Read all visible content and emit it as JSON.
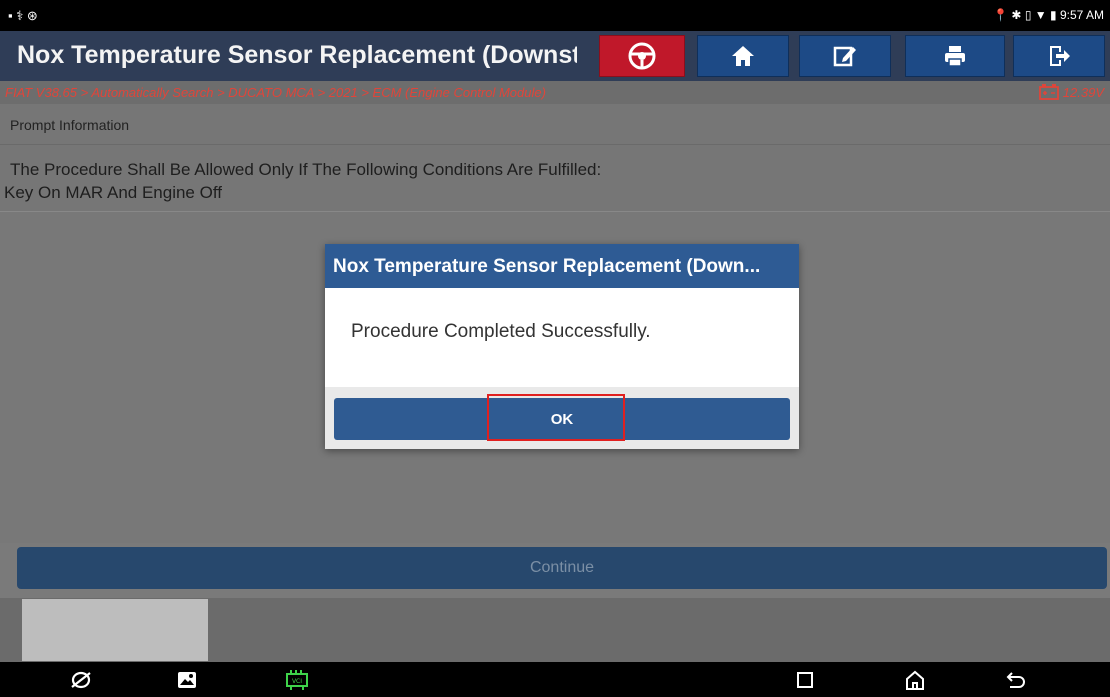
{
  "status_bar": {
    "left_icons": "▪ ⚕ ⊛",
    "time": "9:57 AM",
    "icons": [
      "location-icon",
      "bluetooth-icon",
      "vibrate-icon",
      "wifi-icon",
      "battery-icon"
    ]
  },
  "header": {
    "title": "Nox Temperature Sensor Replacement (Downst",
    "buttons": [
      "steering-wheel-icon",
      "home-icon",
      "edit-icon",
      "print-icon",
      "exit-icon"
    ],
    "colors": {
      "active": "#c0182a",
      "normal": "#1d4a86",
      "bar": "#2f3d57"
    }
  },
  "breadcrumb": {
    "path": "FIAT V38.65 > Automatically Search > DUCATO MCA > 2021 > ECM (Engine Control Module)",
    "voltage": "12.39V",
    "color": "#e0453a"
  },
  "prompt": {
    "heading": "Prompt Information",
    "line1": "The Procedure Shall Be Allowed Only If The Following Conditions Are Fulfilled:",
    "line2": "Key On MAR And Engine Off"
  },
  "dialog": {
    "title": "Nox Temperature Sensor Replacement (Down...",
    "message": "Procedure Completed Successfully.",
    "ok_label": "OK"
  },
  "footer": {
    "continue_label": "Continue"
  },
  "nav_bar": {
    "icons": [
      "browser-icon",
      "gallery-icon",
      "vci-icon",
      "recents-icon",
      "home-nav-icon",
      "back-icon"
    ]
  }
}
